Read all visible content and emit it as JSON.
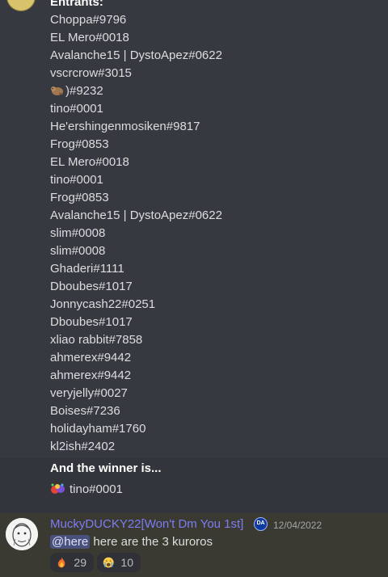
{
  "entrants": {
    "title": "Entrants:",
    "items": [
      "Choppa#9796",
      "EL Mero#0018",
      "Avalanche15 | DystoApez#0622",
      "vscrcrow#3015",
      ")#9232",
      "tino#0001",
      "He'ershingenmosiken#9817",
      "Frog#0853",
      "EL Mero#0018",
      "tino#0001",
      "Frog#0853",
      "Avalanche15 | DystoApez#0622",
      "slim#0008",
      "slim#0008",
      "Ghaderi#1111",
      "Dboubes#1017",
      "Jonnycash22#0251",
      "Dboubes#1017",
      "xliao rabbit#7858",
      "ahmerex#9442",
      "ahmerex#9442",
      "veryjelly#0027",
      "Boises#7236",
      "holidayham#1760",
      "kl2ish#2402"
    ]
  },
  "winner": {
    "title": "And the winner is...",
    "name": "tino#0001",
    "emoji_icon": "confetti-emoji"
  },
  "message": {
    "username": "MuckyDUCKY22[Won't Dm You 1st]",
    "badge_text": "DA",
    "timestamp": "12/04/2022",
    "mention": "@here",
    "text": " here are the 3 kuroros",
    "reactions": [
      {
        "icon": "fire-emoji",
        "count": "29"
      },
      {
        "icon": "crying-emoji",
        "count": "10"
      }
    ]
  },
  "colors": {
    "background": "#36393f",
    "username": "#7e7cf5",
    "mention_bg": "#48507c"
  }
}
